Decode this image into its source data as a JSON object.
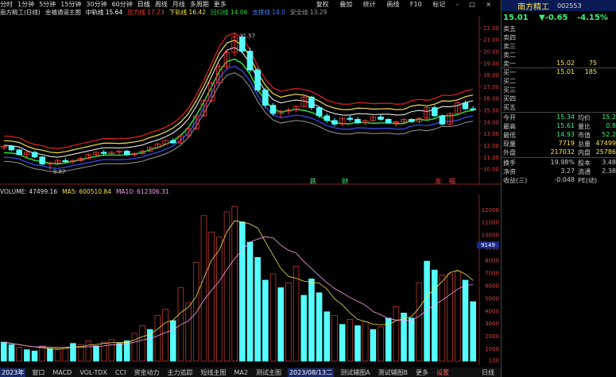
{
  "toolbar": {
    "periods": [
      "分时",
      "1分钟",
      "5分钟",
      "15分钟",
      "30分钟",
      "60分钟",
      "日线",
      "周线",
      "月线",
      "多周期",
      "更多"
    ],
    "right_tools": [
      "复权",
      "叠加",
      "统计",
      "画线",
      "F10",
      "标记",
      "-",
      "□",
      "×"
    ]
  },
  "legend": {
    "stock": "南方精工(日线)",
    "indicator": "金福通道主图",
    "middle_label": "中轨线",
    "middle_value": "15.64",
    "pressure_label": "压力线",
    "pressure_value": "17.23",
    "lower_label": "下轨线",
    "lower_value": "16.42",
    "returnline_label": "回归线",
    "returnline_value": "14.06",
    "support_label": "支撑线",
    "support_value": "14.0",
    "safe_label": "安全线",
    "safe_value": "13.29"
  },
  "price_axis": [
    "22.00",
    "21.00",
    "20.00",
    "19.00",
    "18.00",
    "17.00",
    "16.00",
    "15.00",
    "14.00",
    "13.00",
    "12.00",
    "11.00",
    "10.00"
  ],
  "price_annotations": {
    "high": "21.57",
    "low": "9.87",
    "sell_label": "跌",
    "sell2_label": "财",
    "buy_label": "涨",
    "buy2_label": "幅"
  },
  "volume_legend": {
    "volume": "VOLUME: 47499.16",
    "ma5": "MA5: 600510.84",
    "ma10": "MA10: 612306.31"
  },
  "volume_axis": [
    "12000",
    "11000",
    "10000",
    "9000",
    "8000",
    "7000",
    "6000",
    "5000",
    "4000",
    "3000",
    "2000",
    "1000",
    "100"
  ],
  "volume_marker": "9149",
  "bottom_tabs": [
    "2023年",
    "窗口",
    "MACD",
    "VOL-TDX",
    "CCI",
    "资金动力",
    "主力追踪",
    "短线主图",
    "MA2",
    "测试主图",
    "2023/08/13二",
    "测试辅图A",
    "测试辅图B",
    "更多",
    "设置"
  ],
  "bottom_right": "日线",
  "quote": {
    "name": "南方精工",
    "code": "002553",
    "price": "15.01",
    "change": "▼-0.65",
    "change_pct": "-4.15%",
    "ask_levels": [
      {
        "label": "卖五",
        "price": "",
        "vol": ""
      },
      {
        "label": "卖四",
        "price": "",
        "vol": ""
      },
      {
        "label": "卖三",
        "price": "",
        "vol": ""
      },
      {
        "label": "卖二",
        "price": "",
        "vol": ""
      },
      {
        "label": "卖一",
        "price": "15.02",
        "vol": "75"
      }
    ],
    "bid_levels": [
      {
        "label": "买一",
        "price": "15.01",
        "vol": "185"
      },
      {
        "label": "买二",
        "price": "",
        "vol": ""
      },
      {
        "label": "买三",
        "price": "",
        "vol": ""
      },
      {
        "label": "买四",
        "price": "",
        "vol": ""
      },
      {
        "label": "买五",
        "price": "",
        "vol": ""
      }
    ],
    "stats": [
      {
        "l1": "今开",
        "v1": "15.34",
        "l2": "均价",
        "v2": "15.2"
      },
      {
        "l1": "最高",
        "v1": "15.61",
        "l2": "量比",
        "v2": "0.8"
      },
      {
        "l1": "最低",
        "v1": "14.93",
        "l2": "市值",
        "v2": "52.2"
      },
      {
        "l1": "现量",
        "v1": "7719",
        "l2": "总量",
        "v2": "47499"
      },
      {
        "l1": "外盘",
        "v1": "217032",
        "l2": "内盘",
        "v2": "25786"
      }
    ],
    "stats2": [
      {
        "l1": "换手",
        "v1": "19.98%",
        "l2": "股本",
        "v2": "3.48"
      },
      {
        "l1": "净资",
        "v1": "3.27",
        "l2": "流通",
        "v2": "2.38"
      },
      {
        "l1": "收益(三)",
        "v1": "-0.048",
        "l2": "PE(动)",
        "v2": ""
      }
    ]
  },
  "chart_data": {
    "type": "candlestick",
    "price_range": [
      9.5,
      22.6
    ],
    "candles": [
      [
        11.8,
        12.0,
        11.6,
        11.9
      ],
      [
        11.9,
        12.0,
        11.5,
        11.6
      ],
      [
        11.6,
        11.7,
        11.1,
        11.2
      ],
      [
        11.2,
        11.5,
        11.0,
        11.4
      ],
      [
        11.4,
        11.5,
        10.9,
        11.0
      ],
      [
        11.0,
        11.1,
        10.3,
        10.4
      ],
      [
        10.4,
        10.6,
        9.87,
        10.5
      ],
      [
        10.5,
        10.8,
        10.3,
        10.7
      ],
      [
        10.7,
        10.9,
        10.5,
        10.6
      ],
      [
        10.6,
        10.8,
        10.4,
        10.7
      ],
      [
        10.7,
        11.0,
        10.6,
        10.9
      ],
      [
        10.9,
        11.3,
        10.8,
        11.2
      ],
      [
        11.2,
        11.5,
        11.0,
        11.4
      ],
      [
        11.4,
        11.6,
        11.1,
        11.3
      ],
      [
        11.3,
        11.5,
        11.1,
        11.4
      ],
      [
        11.4,
        11.6,
        11.2,
        11.5
      ],
      [
        11.5,
        11.6,
        11.1,
        11.2
      ],
      [
        11.2,
        11.4,
        11.0,
        11.3
      ],
      [
        11.3,
        11.6,
        11.2,
        11.5
      ],
      [
        11.5,
        11.9,
        11.4,
        11.8
      ],
      [
        11.8,
        12.2,
        11.7,
        12.1
      ],
      [
        12.1,
        12.5,
        12.0,
        12.4
      ],
      [
        12.4,
        12.6,
        12.1,
        12.2
      ],
      [
        12.2,
        12.9,
        12.1,
        12.8
      ],
      [
        12.8,
        13.5,
        12.7,
        13.4
      ],
      [
        13.4,
        14.6,
        13.3,
        14.5
      ],
      [
        14.5,
        15.9,
        14.4,
        15.8
      ],
      [
        15.8,
        17.4,
        15.6,
        17.3
      ],
      [
        17.3,
        19.0,
        17.0,
        18.7
      ],
      [
        18.7,
        20.2,
        18.4,
        19.9
      ],
      [
        19.9,
        21.57,
        19.6,
        21.2
      ],
      [
        21.2,
        21.4,
        19.8,
        20.0
      ],
      [
        20.0,
        20.3,
        18.2,
        18.4
      ],
      [
        18.4,
        18.6,
        16.5,
        16.7
      ],
      [
        16.7,
        16.9,
        15.2,
        15.4
      ],
      [
        15.4,
        15.6,
        14.5,
        14.7
      ],
      [
        14.7,
        15.0,
        14.3,
        14.9
      ],
      [
        14.9,
        15.2,
        14.6,
        15.0
      ],
      [
        15.0,
        15.4,
        14.8,
        15.3
      ],
      [
        15.3,
        16.3,
        15.2,
        16.1
      ],
      [
        16.1,
        16.2,
        15.0,
        15.2
      ],
      [
        15.2,
        15.3,
        14.3,
        14.5
      ],
      [
        14.5,
        14.7,
        13.9,
        14.1
      ],
      [
        14.1,
        14.3,
        13.6,
        13.8
      ],
      [
        13.8,
        14.4,
        13.7,
        14.3
      ],
      [
        14.3,
        14.6,
        14.0,
        14.2
      ],
      [
        14.2,
        14.4,
        13.8,
        13.9
      ],
      [
        13.9,
        14.2,
        13.7,
        14.1
      ],
      [
        14.1,
        14.5,
        14.0,
        14.4
      ],
      [
        14.4,
        14.6,
        14.1,
        14.2
      ],
      [
        14.2,
        14.3,
        13.8,
        13.9
      ],
      [
        13.9,
        14.1,
        13.6,
        14.0
      ],
      [
        14.0,
        14.3,
        13.9,
        14.2
      ],
      [
        14.2,
        14.3,
        13.9,
        14.0
      ],
      [
        14.0,
        14.4,
        13.9,
        14.3
      ],
      [
        14.3,
        15.3,
        14.2,
        15.2
      ],
      [
        15.2,
        15.4,
        14.4,
        14.5
      ],
      [
        14.5,
        14.6,
        13.7,
        13.8
      ],
      [
        13.8,
        14.8,
        13.7,
        14.7
      ],
      [
        14.7,
        15.7,
        14.6,
        15.6
      ],
      [
        15.6,
        15.8,
        15.0,
        15.1
      ],
      [
        15.1,
        15.3,
        14.9,
        15.01
      ]
    ],
    "volumes": [
      {
        "v": 1500,
        "up": false
      },
      {
        "v": 1300,
        "up": false
      },
      {
        "v": 1100,
        "up": true
      },
      {
        "v": 900,
        "up": false
      },
      {
        "v": 800,
        "up": false
      },
      {
        "v": 1200,
        "up": true
      },
      {
        "v": 1000,
        "up": false
      },
      {
        "v": 900,
        "up": true
      },
      {
        "v": 1100,
        "up": true
      },
      {
        "v": 1400,
        "up": false
      },
      {
        "v": 1300,
        "up": true
      },
      {
        "v": 1600,
        "up": true
      },
      {
        "v": 1200,
        "up": false
      },
      {
        "v": 1500,
        "up": true
      },
      {
        "v": 1700,
        "up": true
      },
      {
        "v": 1400,
        "up": false
      },
      {
        "v": 1600,
        "up": false
      },
      {
        "v": 2200,
        "up": true
      },
      {
        "v": 2800,
        "up": true
      },
      {
        "v": 2500,
        "up": false
      },
      {
        "v": 3600,
        "up": true
      },
      {
        "v": 4100,
        "up": true
      },
      {
        "v": 3200,
        "up": false
      },
      {
        "v": 5800,
        "up": true
      },
      {
        "v": 4600,
        "up": true
      },
      {
        "v": 7800,
        "up": true
      },
      {
        "v": 11500,
        "up": true
      },
      {
        "v": 10200,
        "up": true
      },
      {
        "v": 9800,
        "up": true
      },
      {
        "v": 11800,
        "up": true
      },
      {
        "v": 12200,
        "up": true
      },
      {
        "v": 11000,
        "up": false
      },
      {
        "v": 9400,
        "up": false
      },
      {
        "v": 8200,
        "up": false
      },
      {
        "v": 6400,
        "up": false
      },
      {
        "v": 6900,
        "up": true
      },
      {
        "v": 5800,
        "up": false
      },
      {
        "v": 6200,
        "up": true
      },
      {
        "v": 7500,
        "up": true
      },
      {
        "v": 5200,
        "up": false
      },
      {
        "v": 6500,
        "up": false
      },
      {
        "v": 5400,
        "up": false
      },
      {
        "v": 3900,
        "up": false
      },
      {
        "v": 3600,
        "up": true
      },
      {
        "v": 2900,
        "up": false
      },
      {
        "v": 3300,
        "up": true
      },
      {
        "v": 2800,
        "up": false
      },
      {
        "v": 3100,
        "up": true
      },
      {
        "v": 2500,
        "up": false
      },
      {
        "v": 2700,
        "up": true
      },
      {
        "v": 3400,
        "up": false
      },
      {
        "v": 4300,
        "up": true
      },
      {
        "v": 3800,
        "up": false
      },
      {
        "v": 3400,
        "up": false
      },
      {
        "v": 6200,
        "up": true
      },
      {
        "v": 7900,
        "up": false
      },
      {
        "v": 7200,
        "up": false
      },
      {
        "v": 6800,
        "up": true
      },
      {
        "v": 6900,
        "up": true
      },
      {
        "v": 7100,
        "up": true
      },
      {
        "v": 6400,
        "up": false
      },
      {
        "v": 4700,
        "up": false
      }
    ]
  },
  "colors": {
    "up": "#ff3b3b",
    "down": "#55ffff",
    "band_outer": "#d42020",
    "band_inner": "#f2e24a",
    "band_mid": "#ffffff",
    "band_green": "#29d23c",
    "band_blue": "#2f4ad6",
    "band_gray": "#9a9a9a"
  }
}
